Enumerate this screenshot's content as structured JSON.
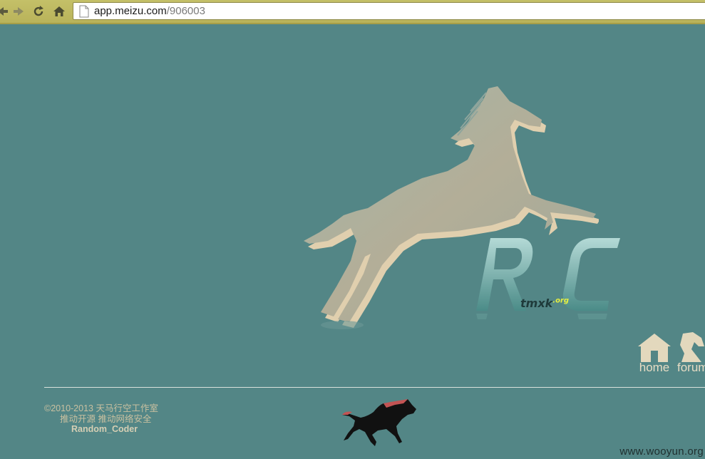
{
  "browser": {
    "url_host": "app.meizu.com",
    "url_path": "/906003"
  },
  "page": {
    "logo_tag": "tmxk",
    "logo_tag_suffix": ".org",
    "nav": {
      "home_label": "home",
      "forum_label": "forum"
    },
    "footer": {
      "copyright": "©2010-2013  天马行空工作室",
      "slogan": "推动开源    推动网络安全",
      "author": "Random_Coder"
    },
    "watermark": "www.wooyun.org"
  },
  "colors": {
    "background": "#538686",
    "toolbar": "#c4c068",
    "horse_fill": "#b3ae98",
    "footer_text": "#c9c0a0"
  },
  "icons": [
    "back-icon",
    "forward-icon",
    "reload-icon",
    "home-icon",
    "page-icon",
    "horse-logo-icon",
    "home-nav-icon",
    "forum-nav-icon"
  ]
}
